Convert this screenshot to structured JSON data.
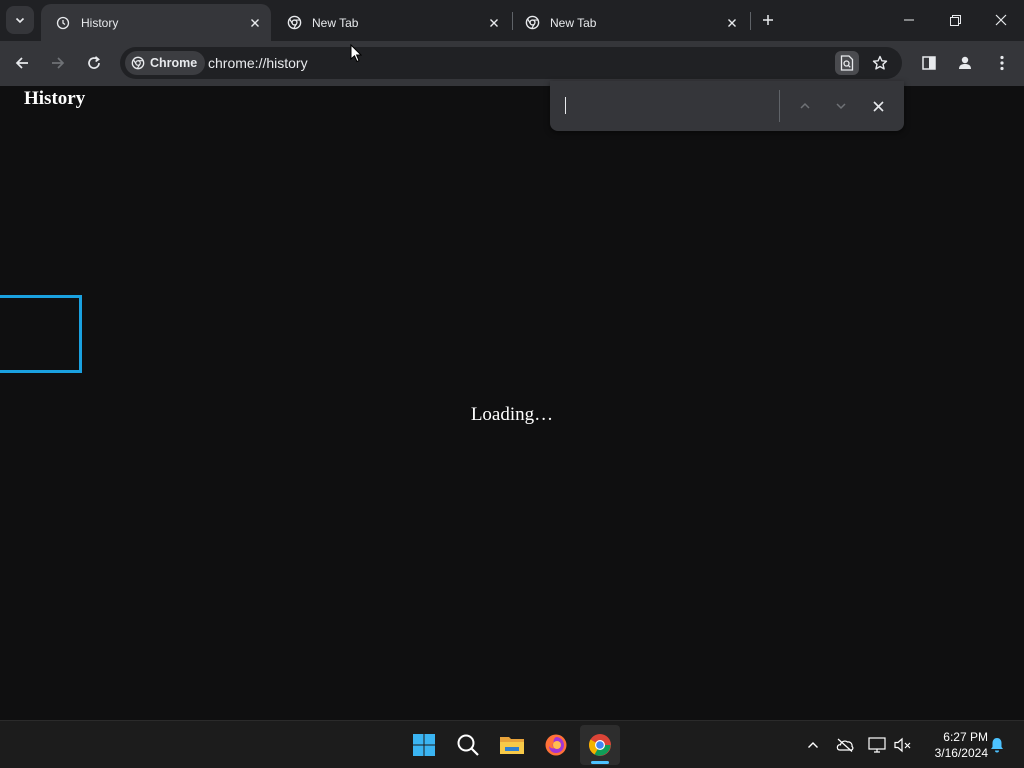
{
  "browser": {
    "tabs": [
      {
        "title": "History",
        "favicon": "history-icon",
        "active": true
      },
      {
        "title": "New Tab",
        "favicon": "chrome-icon",
        "active": false
      },
      {
        "title": "New Tab",
        "favicon": "chrome-icon",
        "active": false
      }
    ],
    "omnibox": {
      "chip_label": "Chrome",
      "url": "chrome://history"
    }
  },
  "page": {
    "heading": "History",
    "loading_text": "Loading…"
  },
  "find_bar": {
    "value": "",
    "placeholder": ""
  },
  "taskbar": {
    "apps": [
      "windows-start-icon",
      "search-icon",
      "file-explorer-icon",
      "firefox-icon",
      "chrome-icon"
    ],
    "active_app": "chrome-icon",
    "clock": {
      "time": "6:27 PM",
      "date": "3/16/2024"
    }
  },
  "colors": {
    "page_bg": "#0f0f10",
    "tabstrip_bg": "#202124",
    "toolbar_bg": "#35363a",
    "focus_outline": "#1aa1e0",
    "taskbar_bg": "#1c1c1c"
  }
}
